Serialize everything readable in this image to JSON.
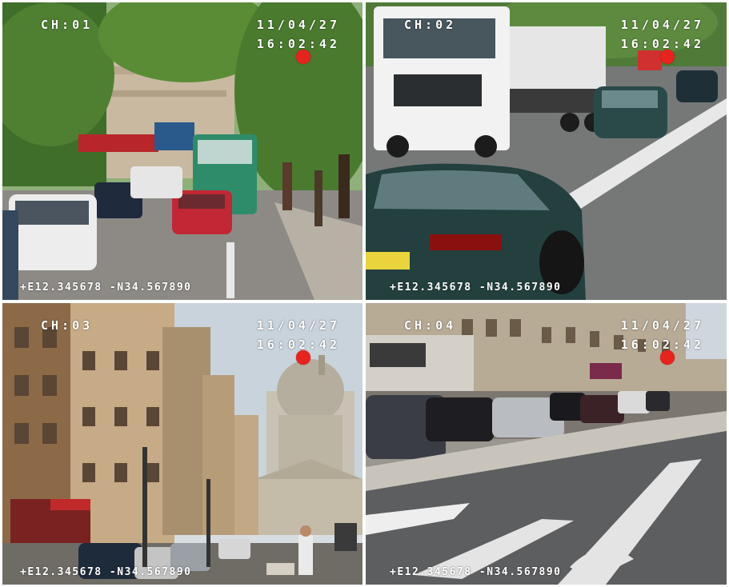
{
  "channels": [
    {
      "label": "CH:01",
      "date": "11/04/27",
      "time": "16:02:42",
      "gps": "+E12.345678  -N34.567890",
      "recording": true
    },
    {
      "label": "CH:02",
      "date": "11/04/27",
      "time": "16:02:42",
      "gps": "+E12.345678  -N34.567890",
      "recording": true
    },
    {
      "label": "CH:03",
      "date": "11/04/27",
      "time": "16:02:42",
      "gps": "+E12.345678  -N34.567890",
      "recording": true
    },
    {
      "label": "CH:04",
      "date": "11/04/27",
      "time": "16:02:42",
      "gps": "+E12.345678  -N34.567890",
      "recording": true
    }
  ],
  "colors": {
    "osd_text": "#ffffff",
    "rec_indicator": "#e8231e",
    "divider": "#ffffff"
  }
}
